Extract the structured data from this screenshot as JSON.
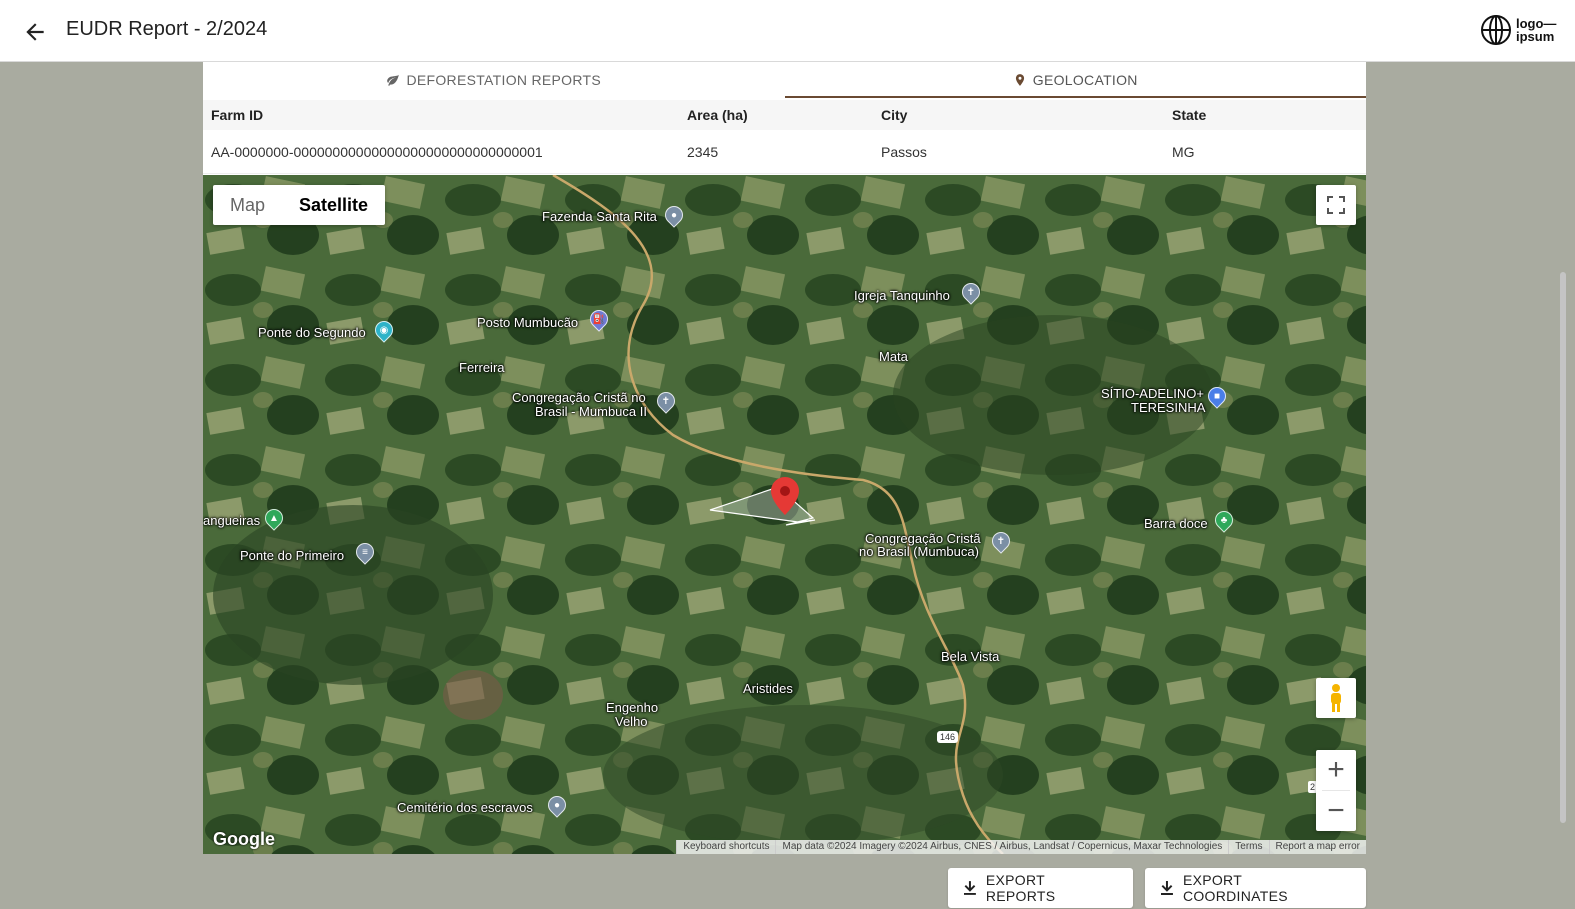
{
  "header": {
    "title": "EUDR Report - 2/2024",
    "logo_text": "logo—ipsum"
  },
  "tabs": [
    {
      "label": "DEFORESTATION REPORTS",
      "icon": "leaf-icon",
      "active": false
    },
    {
      "label": "GEOLOCATION",
      "icon": "location-pin-icon",
      "active": true
    }
  ],
  "table": {
    "headers": [
      "Farm ID",
      "Area (ha)",
      "City",
      "State"
    ],
    "rows": [
      [
        "AA-0000000-00000000000000000000000000000001",
        "2345",
        "Passos",
        "MG"
      ]
    ]
  },
  "map": {
    "type_options": [
      "Map",
      "Satellite"
    ],
    "selected_type": "Satellite",
    "places": [
      "Fazenda Santa Rita",
      "Igreja Tanquinho",
      "Posto Mumbucão",
      "Ponte do Segundo",
      "Mata",
      "Ferreira",
      "Congregação Cristã no",
      "Brasil - Mumbuca II",
      "SÍTIO-ADELINO+",
      "TERESINHA",
      "angueiras",
      "Ponte do Primeiro",
      "Congregação Cristã",
      "no Brasil (Mumbuca)",
      "Barra doce",
      "Bela Vista",
      "Aristides",
      "Engenho",
      "Velho",
      "Cemitério dos escravos"
    ],
    "road_shield": "146",
    "road_shield_2": "2",
    "brand": "Google",
    "attribution": [
      "Keyboard shortcuts",
      "Map data ©2024 Imagery ©2024 Airbus, CNES / Airbus, Landsat / Copernicus, Maxar Technologies",
      "Terms",
      "Report a map error"
    ]
  },
  "actions": {
    "export_reports": "EXPORT REPORTS",
    "export_coordinates": "EXPORT COORDINATES"
  },
  "colors": {
    "accent": "#6a4a32",
    "panel_bg": "#a9aba0",
    "marker": "#e53935"
  }
}
